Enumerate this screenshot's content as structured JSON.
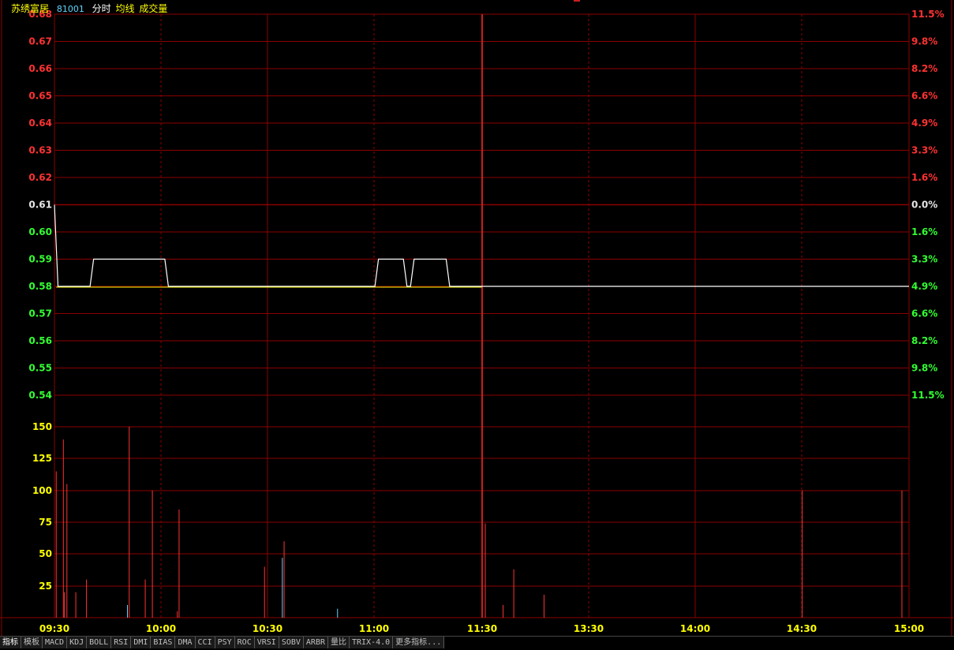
{
  "header": {
    "stock_name": "苏绣富居",
    "stock_code": "81001",
    "chart_mode": "分时",
    "avg_line_label": "均线",
    "volume_label": "成交量"
  },
  "colors": {
    "background": "#000000",
    "grid": "#8b0000",
    "up": "#ff3232",
    "down": "#32ff32",
    "neutral": "#e6e6e6",
    "price_line": "#ffffff",
    "avg_line": "#ffff00",
    "volume_axis": "#ffff00",
    "time_axis": "#ffff00"
  },
  "chart_data": [
    {
      "type": "line",
      "x": [
        "09:30",
        "09:31",
        "09:40",
        "09:41",
        "09:50",
        "09:51",
        "10:01",
        "10:02",
        "11:00",
        "11:01",
        "11:08",
        "11:09",
        "11:10",
        "11:11",
        "11:20",
        "11:21",
        "11:30",
        "13:00",
        "15:00"
      ],
      "series": [
        {
          "values": [
            0.61,
            0.58,
            0.58,
            0.59,
            0.59,
            0.59,
            0.59,
            0.58,
            0.58,
            0.59,
            0.59,
            0.58,
            0.58,
            0.59,
            0.59,
            0.58,
            0.58,
            0.58,
            0.58
          ]
        }
      ],
      "prev_close": 0.61,
      "ylim": [
        0.54,
        0.68
      ],
      "y_ticks_left": [
        "0.68",
        "0.67",
        "0.66",
        "0.65",
        "0.64",
        "0.63",
        "0.62",
        "0.61",
        "0.60",
        "0.59",
        "0.58",
        "0.57",
        "0.56",
        "0.55",
        "0.54"
      ],
      "y_ticks_right": [
        "11.5%",
        "9.8%",
        "8.2%",
        "6.6%",
        "4.9%",
        "3.3%",
        "1.6%",
        "0.0%",
        "1.6%",
        "3.3%",
        "4.9%",
        "6.6%",
        "8.2%",
        "9.8%",
        "11.5%"
      ],
      "x_ticks": [
        "09:30",
        "10:00",
        "10:30",
        "11:00",
        "11:30",
        "13:30",
        "14:00",
        "14:30",
        "15:00"
      ]
    },
    {
      "type": "bar",
      "bars": [
        {
          "t": 0.5,
          "v": 115,
          "dir": "up"
        },
        {
          "t": 2.5,
          "v": 140,
          "dir": "up"
        },
        {
          "t": 2.8,
          "v": 20,
          "dir": "up"
        },
        {
          "t": 3.5,
          "v": 105,
          "dir": "up"
        },
        {
          "t": 6,
          "v": 20,
          "dir": "up"
        },
        {
          "t": 9,
          "v": 30,
          "dir": "up"
        },
        {
          "t": 20.5,
          "v": 10,
          "dir": "down"
        },
        {
          "t": 21,
          "v": 150,
          "dir": "up"
        },
        {
          "t": 25.5,
          "v": 30,
          "dir": "up"
        },
        {
          "t": 27.5,
          "v": 100,
          "dir": "up"
        },
        {
          "t": 34.5,
          "v": 5,
          "dir": "up"
        },
        {
          "t": 35,
          "v": 85,
          "dir": "up"
        },
        {
          "t": 59,
          "v": 40,
          "dir": "up"
        },
        {
          "t": 64,
          "v": 47,
          "dir": "down"
        },
        {
          "t": 64.5,
          "v": 60,
          "dir": "up"
        },
        {
          "t": 79.5,
          "v": 7,
          "dir": "down"
        },
        {
          "t": 121,
          "v": 74,
          "dir": "up"
        },
        {
          "t": 126,
          "v": 10,
          "dir": "up"
        },
        {
          "t": 129,
          "v": 38,
          "dir": "up"
        },
        {
          "t": 137.5,
          "v": 18,
          "dir": "up"
        },
        {
          "t": 210,
          "v": 100,
          "dir": "up"
        },
        {
          "t": 238,
          "v": 100,
          "dir": "up"
        }
      ],
      "ylim": [
        0,
        150
      ],
      "y_ticks": [
        "150",
        "125",
        "100",
        "75",
        "50",
        "25"
      ]
    }
  ],
  "tabs": [
    "指标",
    "模板",
    "MACD",
    "KDJ",
    "BOLL",
    "RSI",
    "DMI",
    "BIAS",
    "DMA",
    "CCI",
    "PSY",
    "ROC",
    "VRSI",
    "SOBV",
    "ARBR",
    "量比",
    "TRIX-4.0",
    "更多指标..."
  ]
}
